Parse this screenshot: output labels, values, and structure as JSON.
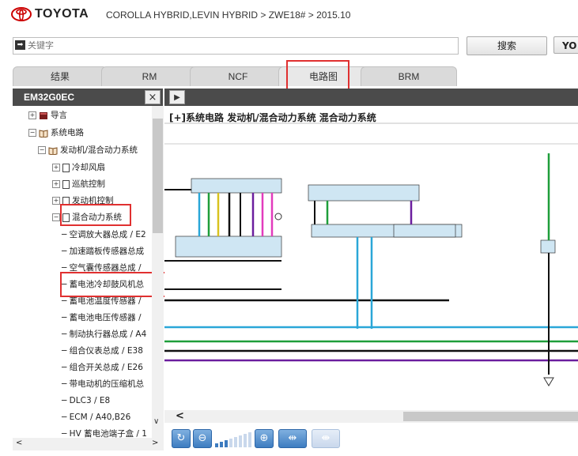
{
  "header": {
    "brand": "TOYOTA",
    "breadcrumb": "COROLLA HYBRID,LEVIN HYBRID > ZWE18# > 2015.10"
  },
  "search": {
    "placeholder": "关键字",
    "button_label": "搜索",
    "extra_button_label": "YO"
  },
  "tabs": [
    {
      "label": "结果"
    },
    {
      "label": "RM"
    },
    {
      "label": "NCF"
    },
    {
      "label": "电路图",
      "active": true
    },
    {
      "label": "BRM"
    }
  ],
  "left_panel": {
    "title": "EM32G0EC",
    "close_label": "×",
    "tree": [
      {
        "label": "导言",
        "icon": "book-icon",
        "expander": "+"
      },
      {
        "label": "系统电路",
        "icon": "book-open-icon",
        "expander": "−"
      },
      {
        "label": "发动机/混合动力系统",
        "icon": "book-open-icon",
        "expander": "−"
      },
      {
        "label": "冷却风扇",
        "icon": "page-icon",
        "expander": "+"
      },
      {
        "label": "巡航控制",
        "icon": "page-icon",
        "expander": "+"
      },
      {
        "label": "发动机控制",
        "icon": "page-icon",
        "expander": "+"
      },
      {
        "label": "混合动力系统",
        "icon": "page-icon",
        "expander": "−",
        "selected": true
      },
      {
        "label": "空调放大器总成 / E2"
      },
      {
        "label": "加速踏板传感器总成"
      },
      {
        "label": "空气囊传感器总成 /"
      },
      {
        "label": "蓄电池冷却鼓风机总"
      },
      {
        "label": "蓄电池温度传感器 /"
      },
      {
        "label": "蓄电池电压传感器 /"
      },
      {
        "label": "制动执行器总成 / A4"
      },
      {
        "label": "组合仪表总成 / E38"
      },
      {
        "label": "组合开关总成 / E26"
      },
      {
        "label": "带电动机的压缩机总"
      },
      {
        "label": "DLC3 / E8"
      },
      {
        "label": "ECM / A40,B26"
      },
      {
        "label": "HV 蓄电池端子盒 / 1"
      }
    ]
  },
  "diagram": {
    "title": "[+]系统电路  发动机/混合动力系统  混合动力系统",
    "wire_colors": {
      "black": "#111111",
      "cyan": "#2aa7d8",
      "green": "#1e9e3a",
      "purple": "#6b1e9e",
      "yellow": "#d8c21e",
      "pink": "#e23bbd",
      "box": "#cfe6f3"
    }
  },
  "toolbar": {
    "icons": [
      "refresh-icon",
      "zoom-out-icon",
      "zoom-level-indicator",
      "zoom-in-icon",
      "expand-icon",
      "collapse-icon"
    ],
    "zoom_level": 3
  }
}
